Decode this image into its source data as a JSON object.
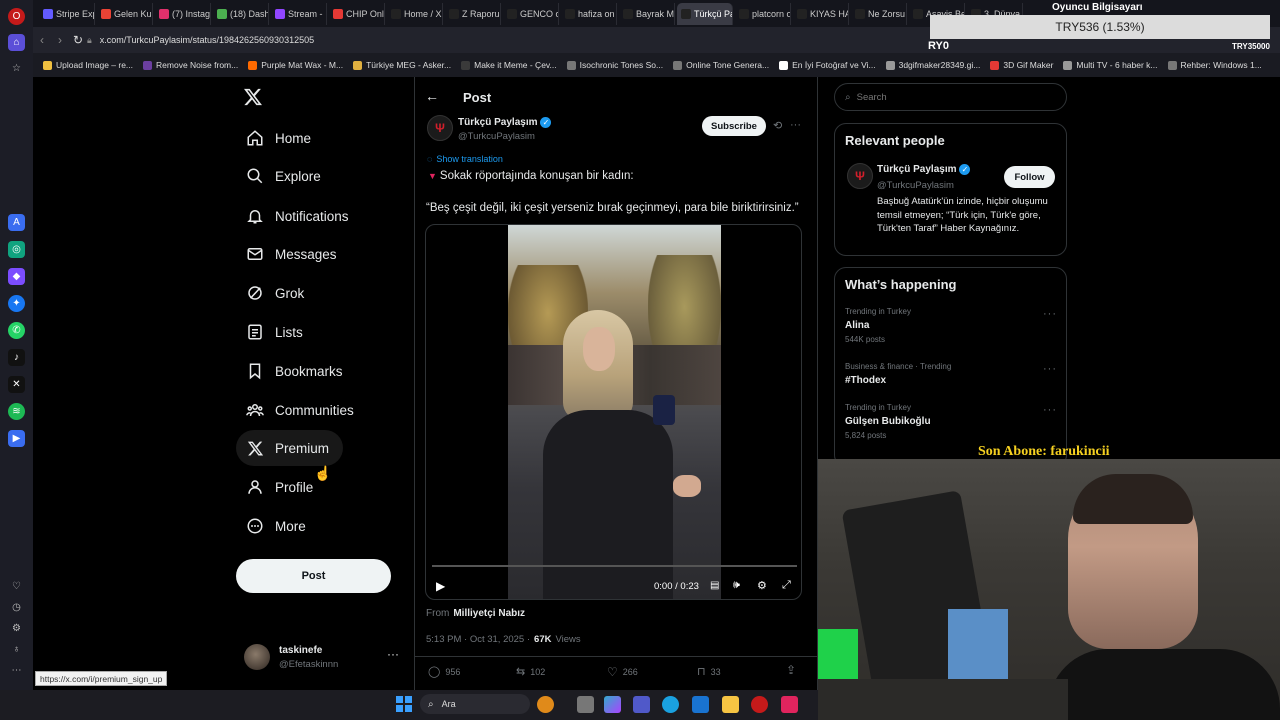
{
  "browser": {
    "tabs": [
      {
        "label": "Stripe Exp",
        "color": "#635bff"
      },
      {
        "label": "Gelen Ku",
        "color": "#ea4335"
      },
      {
        "label": "(7) Instag",
        "color": "#e1306c"
      },
      {
        "label": "(18) Dash",
        "color": "#4caf50"
      },
      {
        "label": "Stream -",
        "color": "#9146ff"
      },
      {
        "label": "CHIP Onl",
        "color": "#e53935"
      },
      {
        "label": "Home / X",
        "color": "#222"
      },
      {
        "label": "Z Raporu",
        "color": "#222"
      },
      {
        "label": "GENCO o",
        "color": "#222"
      },
      {
        "label": "hafiza on",
        "color": "#222"
      },
      {
        "label": "Bayrak M",
        "color": "#222"
      },
      {
        "label": "Türkçü Paylaşım",
        "color": "#222",
        "active": true
      },
      {
        "label": "platcorn o",
        "color": "#222"
      },
      {
        "label": "KIYAS HA",
        "color": "#222"
      },
      {
        "label": "Ne Zorsu",
        "color": "#222"
      },
      {
        "label": "Asayis Be",
        "color": "#222"
      },
      {
        "label": "3. Dünya",
        "color": "#222"
      }
    ],
    "url": "x.com/TurkcuPaylasim/status/1984262560930312505",
    "bookmarks": [
      {
        "label": "Upload Image – re...",
        "color": "#f0c040"
      },
      {
        "label": "Remove Noise from...",
        "color": "#6b3fa0"
      },
      {
        "label": "Purple Mat Wax - M...",
        "color": "#ff6a00"
      },
      {
        "label": "Türkiye MEG - Asker...",
        "color": "#e0b040"
      },
      {
        "label": "Make it Meme - Çev...",
        "color": "#3a3a3a"
      },
      {
        "label": "Isochronic Tones So...",
        "color": "#777"
      },
      {
        "label": "Online Tone Genera...",
        "color": "#777"
      },
      {
        "label": "En İyi Fotoğraf ve Vi...",
        "color": "#fff"
      },
      {
        "label": "3dgifmaker28349.gi...",
        "color": "#999"
      },
      {
        "label": "3D Gif Maker",
        "color": "#e53935"
      },
      {
        "label": "Multi TV - 6 haber k...",
        "color": "#999"
      },
      {
        "label": "Rehber: Windows 1...",
        "color": "#777"
      }
    ],
    "status_link": "https://x.com/i/premium_sign_up"
  },
  "overlay": {
    "ticker": "TRY536 (1.53%)",
    "ticker_small": "TRY35000",
    "ticker_left": "RY0",
    "top_label": "Oyuncu Bilgisayarı",
    "subscriber": "Son Abone: farukincii"
  },
  "nav": {
    "items": [
      {
        "label": "Home",
        "icon": "home-icon"
      },
      {
        "label": "Explore",
        "icon": "search-icon"
      },
      {
        "label": "Notifications",
        "icon": "bell-icon"
      },
      {
        "label": "Messages",
        "icon": "mail-icon"
      },
      {
        "label": "Grok",
        "icon": "grok-icon"
      },
      {
        "label": "Lists",
        "icon": "list-icon"
      },
      {
        "label": "Bookmarks",
        "icon": "bookmark-icon"
      },
      {
        "label": "Communities",
        "icon": "communities-icon"
      },
      {
        "label": "Premium",
        "icon": "x-logo-icon"
      },
      {
        "label": "Profile",
        "icon": "profile-icon"
      },
      {
        "label": "More",
        "icon": "more-circle-icon"
      }
    ],
    "post_button": "Post",
    "account": {
      "name": "taskinefe",
      "handle": "@Efetaskinnn"
    }
  },
  "post": {
    "header_title": "Post",
    "author": "Türkçü Paylaşım",
    "handle": "@TurkcuPaylasim",
    "subscribe": "Subscribe",
    "show_translation": "Show translation",
    "line1": "Sokak röportajında konuşan bir kadın:",
    "line2": "“Beş çeşit değil, iki çeşit yerseniz bırak geçinmeyi, para bile biriktirirsiniz.”",
    "video_time": "0:00 / 0:23",
    "video_progress": 0,
    "from_label": "From",
    "from_source": "Milliyetçi Nabız",
    "timestamp": "5:13 PM · Oct 31, 2025 ·",
    "views": "67K",
    "views_label": "Views",
    "replies": "956",
    "reposts": "102",
    "likes": "266",
    "bookmarks": "33"
  },
  "right": {
    "search_placeholder": "Search",
    "relevant_title": "Relevant people",
    "person": {
      "name": "Türkçü Paylaşım",
      "handle": "@TurkcuPaylasim",
      "follow": "Follow",
      "bio": "Başbuğ Atatürk'ün izinde, hiçbir oluşumu temsil etmeyen; “Türk için, Türk'e göre, Türk'ten Taraf” Haber Kaynağınız."
    },
    "happening_title": "What’s happening",
    "trends": [
      {
        "context": "Trending in Turkey",
        "title": "Alina",
        "count": "544K posts"
      },
      {
        "context": "Business & finance · Trending",
        "title": "#Thodex",
        "count": ""
      },
      {
        "context": "Trending in Turkey",
        "title": "Gülşen Bubikoğlu",
        "count": "5,824 posts"
      }
    ]
  },
  "taskbar": {
    "search": "Ara"
  },
  "colors": {
    "accent": "#1d9bf0",
    "verified": "#1d9bf0",
    "subscriber_text": "#f5d020"
  }
}
